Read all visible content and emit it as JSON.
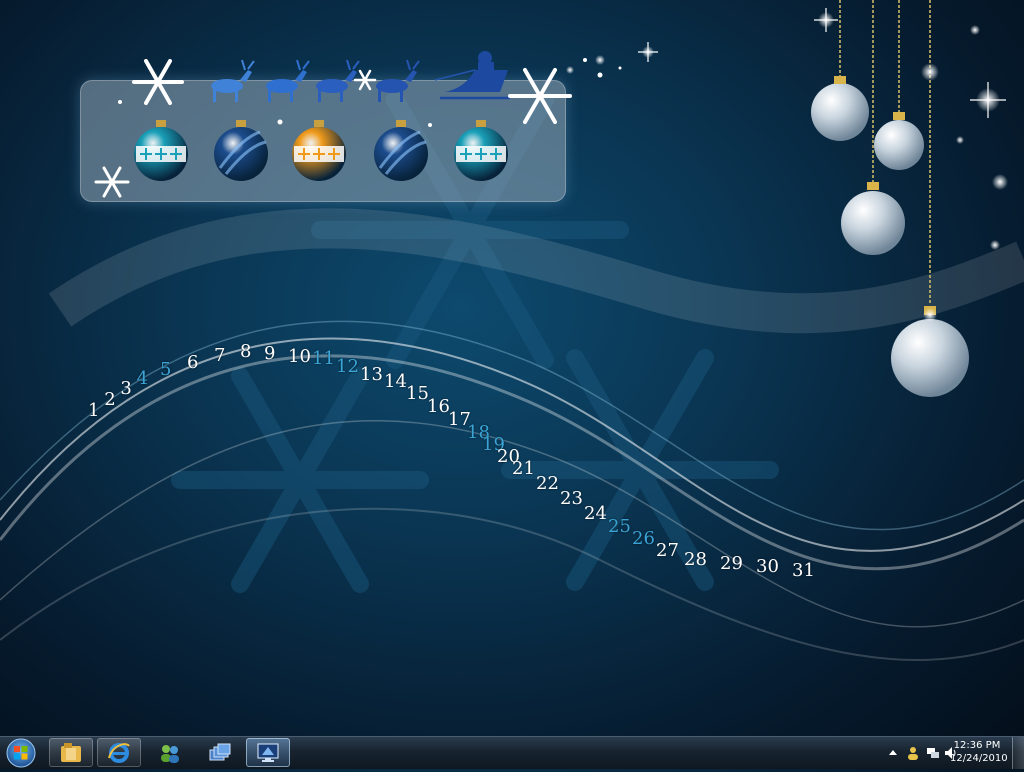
{
  "calendar": {
    "days": [
      {
        "label": "1",
        "hl": false
      },
      {
        "label": "2",
        "hl": false
      },
      {
        "label": "3",
        "hl": false
      },
      {
        "label": "4",
        "hl": true
      },
      {
        "label": "5",
        "hl": true
      },
      {
        "label": "6",
        "hl": false
      },
      {
        "label": "7",
        "hl": false
      },
      {
        "label": "8",
        "hl": false
      },
      {
        "label": "9",
        "hl": false
      },
      {
        "label": "10",
        "hl": false
      },
      {
        "label": "11",
        "hl": true
      },
      {
        "label": "12",
        "hl": true
      },
      {
        "label": "13",
        "hl": false
      },
      {
        "label": "14",
        "hl": false
      },
      {
        "label": "15",
        "hl": false
      },
      {
        "label": "16",
        "hl": false
      },
      {
        "label": "17",
        "hl": false
      },
      {
        "label": "18",
        "hl": true
      },
      {
        "label": "19",
        "hl": true
      },
      {
        "label": "20",
        "hl": false
      },
      {
        "label": "21",
        "hl": false
      },
      {
        "label": "22",
        "hl": false
      },
      {
        "label": "23",
        "hl": false
      },
      {
        "label": "24",
        "hl": false
      },
      {
        "label": "25",
        "hl": true
      },
      {
        "label": "26",
        "hl": true
      },
      {
        "label": "27",
        "hl": false
      },
      {
        "label": "28",
        "hl": false
      },
      {
        "label": "29",
        "hl": false
      },
      {
        "label": "30",
        "hl": false
      },
      {
        "label": "31",
        "hl": false
      }
    ]
  },
  "colors": {
    "day_text": "#ffffff",
    "weekend_text": "#3aa4d6",
    "taskbar": "#17232f"
  },
  "ornament_panel": {
    "ornaments": [
      {
        "icon": "teal-ornament-icon",
        "color": "#1aa0b8"
      },
      {
        "icon": "blue-striped-ornament-icon",
        "color": "#1c4c8c"
      },
      {
        "icon": "orange-ornament-icon",
        "color": "#f09a1a"
      },
      {
        "icon": "blue-striped-ornament-icon",
        "color": "#1c4c8c"
      },
      {
        "icon": "teal-ornament-icon",
        "color": "#1aa0b8"
      }
    ]
  },
  "taskbar": {
    "start_icon": "windows-logo-icon",
    "pinned": [
      {
        "name": "explorer",
        "icon": "folder-icon"
      },
      {
        "name": "internet-explorer",
        "icon": "ie-icon"
      },
      {
        "name": "messenger",
        "icon": "contacts-icon"
      },
      {
        "name": "switch-windows",
        "icon": "window-stack-icon"
      },
      {
        "name": "remote-desktop",
        "icon": "monitor-icon"
      }
    ],
    "tray": {
      "icons": [
        "show-hidden-icons-arrow",
        "user-icon",
        "network-icon",
        "volume-icon"
      ],
      "time": "12:36 PM",
      "date": "12/24/2010"
    }
  }
}
